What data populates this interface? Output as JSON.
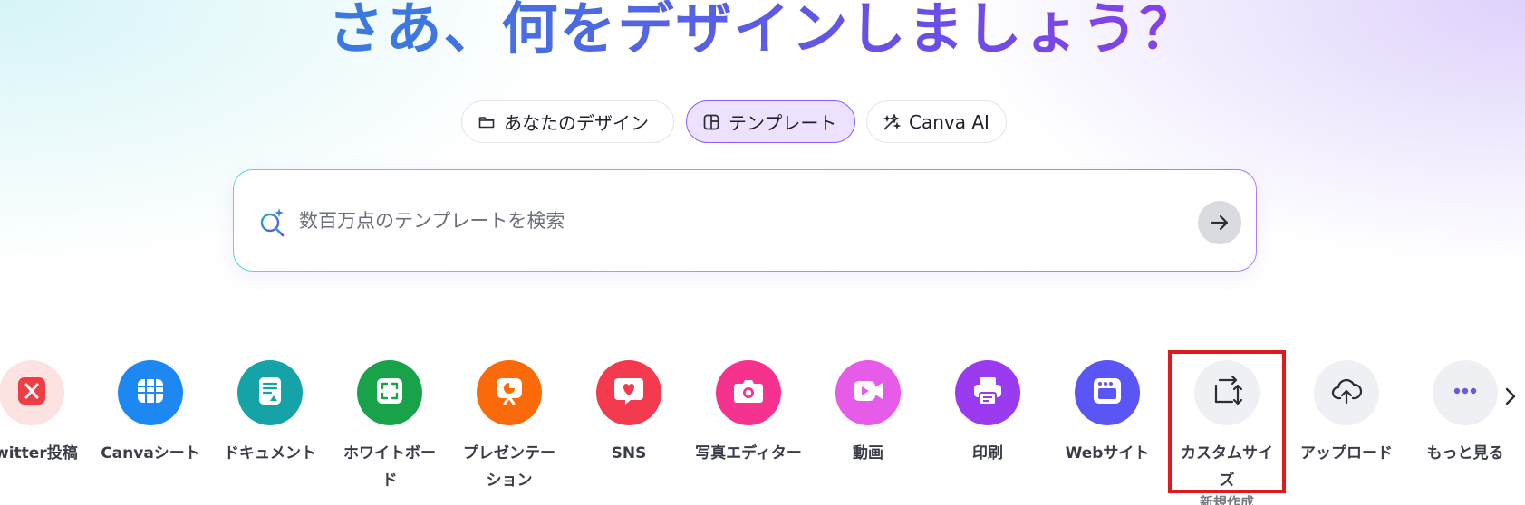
{
  "hero": {
    "title": "さあ、何をデザインしましょう？"
  },
  "tabs": [
    {
      "label": "あなたのデザイン",
      "icon": "folder-icon"
    },
    {
      "label": "テンプレート",
      "icon": "template-icon",
      "active": true
    },
    {
      "label": "Canva AI",
      "icon": "sparkle-icon"
    }
  ],
  "search": {
    "placeholder": "数百万点のテンプレートを検索",
    "value": ""
  },
  "shortcuts": [
    {
      "label": "Twitter投稿",
      "icon": "x-twitter-icon",
      "color": "#fde2e2"
    },
    {
      "label": "Canvaシート",
      "icon": "sheet-icon",
      "color": "#1e88f2"
    },
    {
      "label": "ドキュメント",
      "icon": "document-icon",
      "color": "#16a3a8"
    },
    {
      "label": "ホワイトボード",
      "icon": "whiteboard-icon",
      "color": "#18a34a"
    },
    {
      "label": "プレゼンテーション",
      "icon": "presentation-icon",
      "color": "#fb6a0a"
    },
    {
      "label": "SNS",
      "icon": "heart-chat-icon",
      "color": "#f33a4e"
    },
    {
      "label": "写真エディター",
      "icon": "camera-icon",
      "color": "#f5338e"
    },
    {
      "label": "動画",
      "icon": "video-icon",
      "color": "#e65ce8"
    },
    {
      "label": "印刷",
      "icon": "printer-icon",
      "color": "#9b3bf0"
    },
    {
      "label": "Webサイト",
      "icon": "website-icon",
      "color": "#5a55f5"
    },
    {
      "label": "カスタムサイズ",
      "icon": "resize-icon",
      "color": "#eef0f3",
      "badge": "新規作成"
    },
    {
      "label": "アップロード",
      "icon": "cloud-upload-icon",
      "color": "#eef0f3"
    },
    {
      "label": "もっと見る",
      "icon": "more-dots-icon",
      "color": "#eef0f3"
    }
  ]
}
